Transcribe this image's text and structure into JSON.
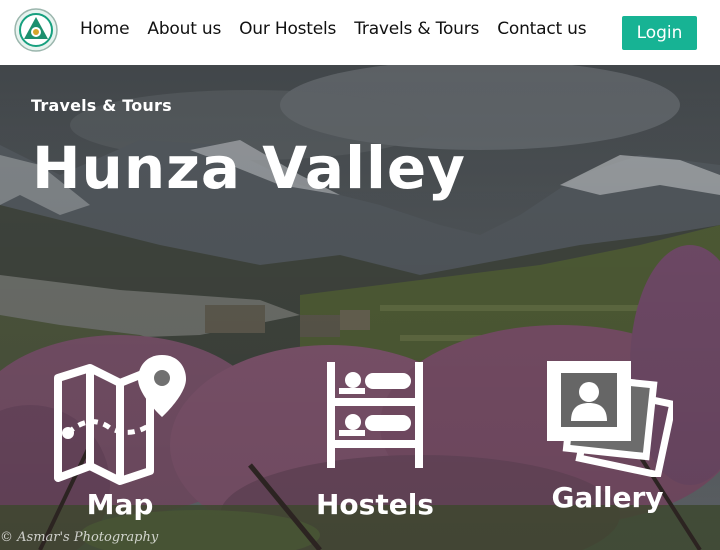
{
  "nav": {
    "logo_icon": "logo-emblem-icon",
    "links": [
      "Home",
      "About us",
      "Our Hostels",
      "Travels & Tours",
      "Contact us"
    ],
    "login_label": "Login",
    "accent_color": "#17b394"
  },
  "hero": {
    "subtitle": "Travels & Tours",
    "title": "Hunza Valley",
    "watermark": "© Asmar's Photography"
  },
  "features": [
    {
      "label": "Map",
      "icon": "map-icon"
    },
    {
      "label": "Hostels",
      "icon": "bunk-bed-icon"
    },
    {
      "label": "Gallery",
      "icon": "photo-gallery-icon"
    }
  ]
}
